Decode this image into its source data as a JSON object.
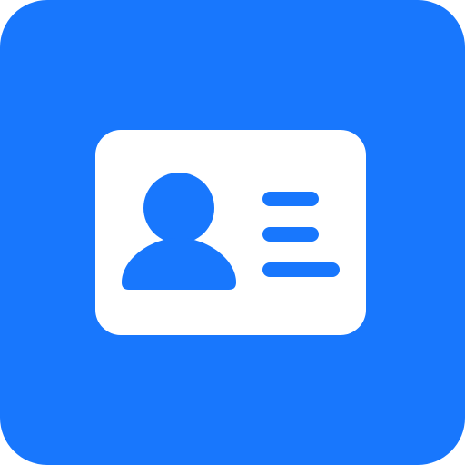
{
  "app_icon": {
    "icon": "contact-card-icon",
    "colors": {
      "tile": "#1877FD",
      "card": "#FFFFFF",
      "glyph": "#1877FD"
    }
  }
}
